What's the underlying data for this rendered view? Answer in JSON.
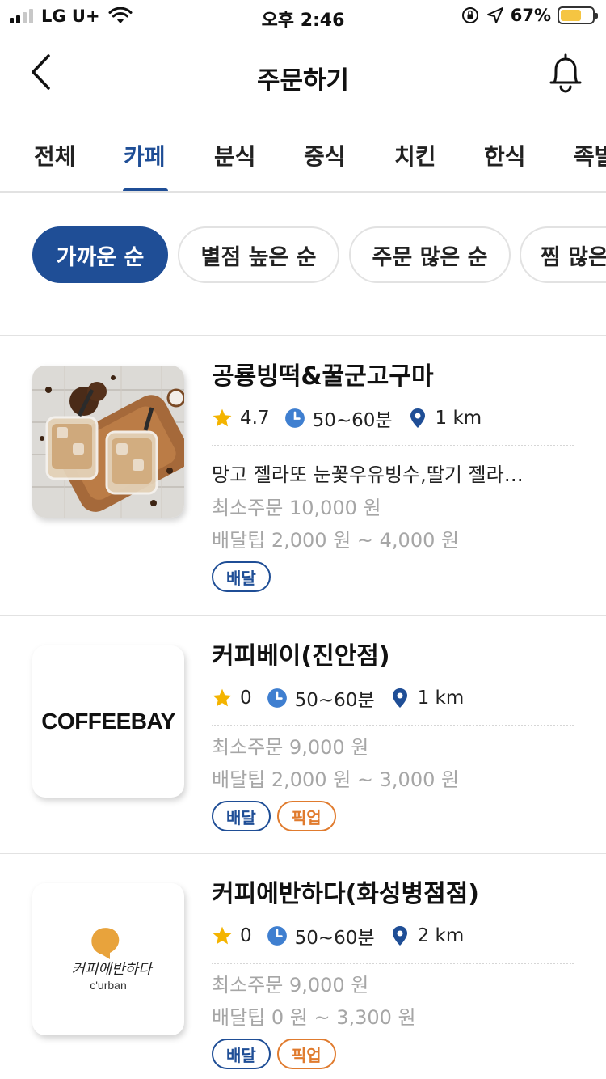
{
  "status_bar": {
    "carrier": "LG U+",
    "time": "오후 2:46",
    "battery_percent": "67%",
    "battery_level": 0.67,
    "battery_color": "#f5c542"
  },
  "header": {
    "title": "주문하기",
    "back_icon": "chevron-left-icon",
    "bell_icon": "bell-icon"
  },
  "tabs": [
    {
      "label": "전체",
      "active": false
    },
    {
      "label": "카페",
      "active": true
    },
    {
      "label": "분식",
      "active": false
    },
    {
      "label": "중식",
      "active": false
    },
    {
      "label": "치킨",
      "active": false
    },
    {
      "label": "한식",
      "active": false
    },
    {
      "label": "족발",
      "active": false
    }
  ],
  "sort_chips": [
    {
      "label": "가까운 순",
      "active": true
    },
    {
      "label": "별점 높은 순",
      "active": false
    },
    {
      "label": "주문 많은 순",
      "active": false
    },
    {
      "label": "찜 많은 순",
      "active": false
    }
  ],
  "colors": {
    "accent": "#1f4e96",
    "pickup": "#e07b2e",
    "star": "#f4b400",
    "clock": "#3f7fd0"
  },
  "stores": [
    {
      "name": "공룡빙떡&꿀군고구마",
      "rating": "4.7",
      "time": "50~60분",
      "distance": "1 km",
      "menu": "망고 젤라또 눈꽃우유빙수,딸기 젤라…",
      "min_order": "최소주문 10,000 원",
      "delivery_tip": "배달팁 2,000 원 ~ 4,000 원",
      "badges": [
        "배달"
      ],
      "thumb": "iced-coffee-photo"
    },
    {
      "name": "커피베이(진안점)",
      "rating": "0",
      "time": "50~60분",
      "distance": "1 km",
      "min_order": "최소주문 9,000 원",
      "delivery_tip": "배달팁 2,000 원 ~ 3,000 원",
      "badges": [
        "배달",
        "픽업"
      ],
      "logo_text": "COFFEEBAY"
    },
    {
      "name": "커피에반하다(화성병점점)",
      "rating": "0",
      "time": "50~60분",
      "distance": "2 km",
      "min_order": "최소주문 9,000 원",
      "delivery_tip": "배달팁 0 원 ~ 3,300 원",
      "badges": [
        "배달",
        "픽업"
      ],
      "logo_script": "커피에반하다",
      "logo_sub": "c'urban"
    }
  ]
}
